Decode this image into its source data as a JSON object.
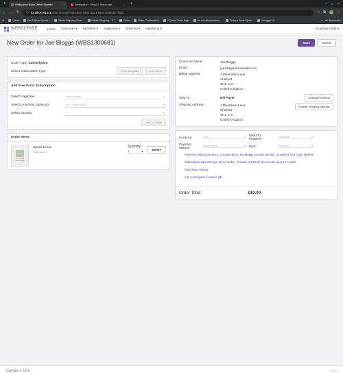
{
  "browser": {
    "tabs": [
      {
        "title": "Webscribe Back Office System",
        "active": true
      },
      {
        "title": "Webscribe ‹ Shop & Subscripti...",
        "active": false
      }
    ],
    "url_host": "localhost:61441",
    "url_path": "/orders/create/495c4b8c-8944-4821-9aac-a6ae0bc7f3ab",
    "bookmarks": [
      "Quote",
      "Get A Smart Quote...",
      "Whole Shipping Sma...",
      "Whale Shipping – S...",
      "Order",
      "Order Confirmation",
      "2 Quote Order Page",
      "be.md-sfbookmarks...",
      "Order A Smart Quot...",
      "Swagger UI"
    ],
    "all_bookmarks": "All Bookmarks"
  },
  "app": {
    "brand": "WEBSCRIBE",
    "nav": [
      "Home",
      "Customer",
      "Publisher",
      "Magazine",
      "Ordering",
      "Reporting"
    ],
    "user": "Jonathan Dodd"
  },
  "page": {
    "title": "New Order for Joe Bloggs (WBS1300681)",
    "save": "Save",
    "cancel": "Cancel"
  },
  "order_type": {
    "label": "Order Type:",
    "value": "Subscription",
    "select_label": "Select Subscription Type:",
    "from_template": "From Template",
    "free_form": "Free Form"
  },
  "free_form": {
    "header": "Add Free Form Subscription",
    "magazine_label": "Select magazine:",
    "magazine_placeholder": "Space News",
    "promotion_label": "Select promotion (optional):",
    "promotion_placeholder": "e.g. Spring 2023",
    "quantity_label": "Select quantity:",
    "quantity_value": "1",
    "add_to_order": "Add To Order"
  },
  "order_items": {
    "header": "Order Items",
    "thumb_caption": "NO IMAGE AVAILABLE",
    "item_title": "Space News",
    "item_sub": "Start issue:",
    "quantity_label": "Quantity:",
    "quantity_value": "1",
    "delete": "Delete"
  },
  "customer": {
    "name_label": "Customer Name:",
    "name": "Joe Bloggs",
    "email_label": "Email:",
    "email": "joe.bloggs@example.com",
    "billing_label": "Billing Address:",
    "billing": [
      "1 Rivermeet Lane",
      "Shelford",
      "SH1 1AA",
      "United Kingdom"
    ],
    "ship_label": "Ship To:",
    "ship_to": "Bill Payer",
    "change_recipient": "Change Recipient",
    "shipping_label": "Shipping Address:",
    "shipping": [
      "1 Rivermeet Lane",
      "Shelford",
      "SH1 1AA",
      "United Kingdom"
    ],
    "change_shipping": "Change Shipping Address"
  },
  "payment": {
    "currency_label": "Currency:",
    "currency": "GBP",
    "billed_label": "Billed To Publisher:",
    "billed": "Unknown",
    "method_label": "Payment Method:",
    "method": "Direct Debit",
    "paid_label": "Paid:",
    "paid": "Pending",
    "summary": "Payment method summary: Account Name: Joe Bloggs Account Number: 12345678 Sort Code: 000099",
    "subscription_type": "Subscription payment type: Direct Debit – 3 issues at £10.00, then £9.00 every 12 months.",
    "start_issue_missing": "Start issue missing.",
    "incentive": "Add subscription incentive gift.",
    "total_label": "Order Total:",
    "total": "£10.00"
  },
  "footer": {
    "copyright": "Copyright © 2025",
    "version": "v.0.9.1"
  }
}
